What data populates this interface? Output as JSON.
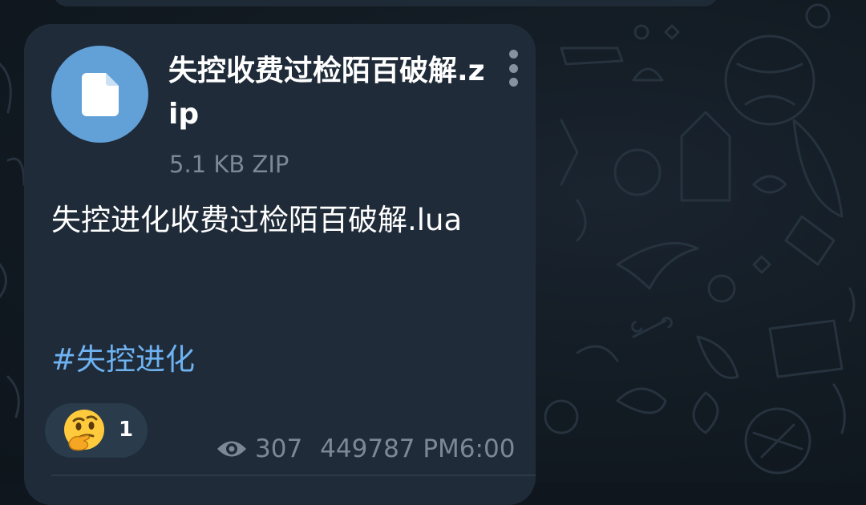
{
  "colors": {
    "background": "#121a22",
    "bubble": "#1f2b38",
    "file_icon_bg": "#62a0d8",
    "hashtag": "#6eb2f2",
    "meta_text": "#7c8896",
    "reaction_bg": "#2a3b4c"
  },
  "message": {
    "file": {
      "icon": "document-icon",
      "name": "失控收费过检陌百破解.zip",
      "size": "5.1 KB ZIP"
    },
    "menu_icon": "more-vertical-icon",
    "caption": "失控进化收费过检陌百破解.lua",
    "hashtag": "#失控进化",
    "reaction": {
      "emoji": "thinking-face-emoji",
      "count": "1"
    },
    "views_icon": "eye-icon",
    "views": "307",
    "author_and_time": "449787 PM6:00"
  }
}
